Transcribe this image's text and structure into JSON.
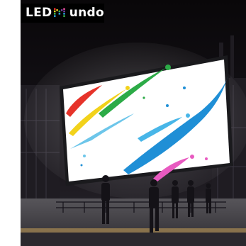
{
  "logo": {
    "prefix": "LED",
    "suffix": "undo",
    "brand_colors": [
      "#e8322b",
      "#f5d020",
      "#3bb34a",
      "#2aa0dc",
      "#7b3fa0",
      "#e94c9a"
    ]
  },
  "colors": {
    "sky": "#0d0a10",
    "screen": "#ffffff",
    "ground": "#3b393f"
  }
}
